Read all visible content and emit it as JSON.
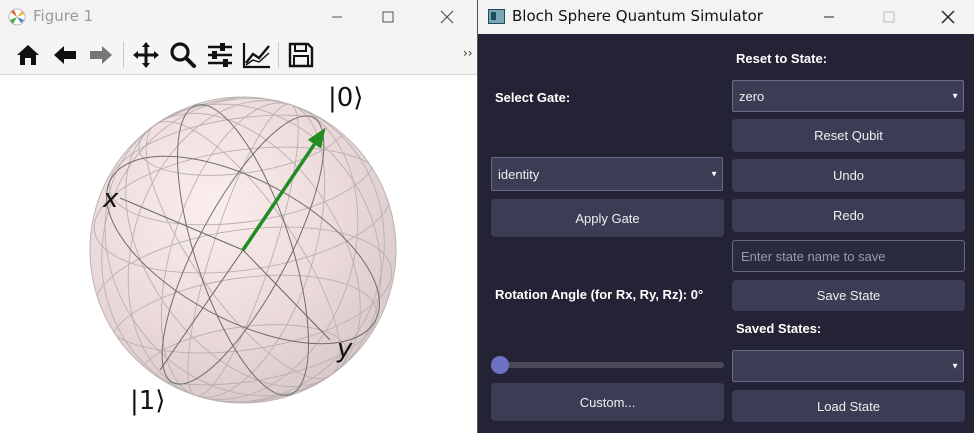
{
  "figure_window": {
    "title": "Figure 1",
    "toolbar_items": [
      "home-icon",
      "back-arrow-icon",
      "forward-arrow-icon",
      "pan-icon",
      "zoom-icon",
      "configure-subplots-icon",
      "edit-axes-icon",
      "save-icon"
    ],
    "overflow_label": "››",
    "plot": {
      "label_top": "|0⟩",
      "label_bottom": "|1⟩",
      "label_x": "x",
      "label_y": "y",
      "state_vector": {
        "x": 0,
        "y": 0,
        "z": 1
      },
      "colors": {
        "vector": "#228b22",
        "sphere": "#f1dede"
      }
    }
  },
  "sim_window": {
    "title": "Bloch Sphere Quantum Simulator",
    "colors": {
      "background": "#232335",
      "button": "#3c3c55",
      "slider_knob": "#6f72c4"
    },
    "select_gate_label": "Select Gate:",
    "gate_value": "identity",
    "apply_gate_label": "Apply Gate",
    "rotation_label": "Rotation Angle (for Rx, Ry, Rz): 0°",
    "rotation_angle": 0,
    "custom_label": "Custom...",
    "reset_to_state_label": "Reset to State:",
    "reset_state_value": "zero",
    "reset_qubit_label": "Reset Qubit",
    "undo_label": "Undo",
    "redo_label": "Redo",
    "state_name_placeholder": "Enter state name to save",
    "save_state_label": "Save State",
    "saved_states_label": "Saved States:",
    "saved_state_value": "",
    "load_state_label": "Load State"
  }
}
